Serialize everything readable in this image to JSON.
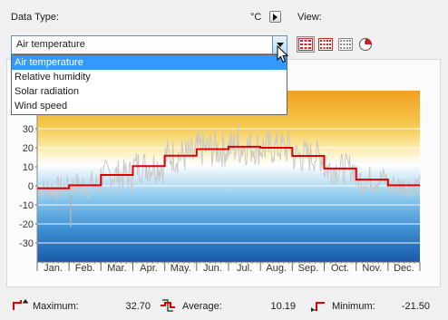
{
  "header": {
    "data_type_label": "Data Type:",
    "unit_label": "°C",
    "view_label": "View:"
  },
  "combo": {
    "selected": "Air temperature",
    "options": [
      "Air temperature",
      "Relative humidity",
      "Solar radiation",
      "Wind speed"
    ]
  },
  "view_buttons": [
    {
      "name": "monthly-view-icon",
      "active": true
    },
    {
      "name": "weekly-view-icon",
      "active": false
    },
    {
      "name": "daily-view-icon",
      "active": false
    },
    {
      "name": "clock-view-icon",
      "active": false
    }
  ],
  "chart_data": {
    "type": "line",
    "x_categories": [
      "Jan.",
      "Feb.",
      "Mar.",
      "Apr.",
      "May.",
      "Jun.",
      "Jul.",
      "Aug.",
      "Sep.",
      "Oct.",
      "Nov.",
      "Dec."
    ],
    "y_ticks": [
      30,
      20,
      10,
      0,
      -10,
      -20,
      -30
    ],
    "ylim": [
      -40,
      50
    ],
    "series": [
      {
        "kind": "monthly-average-step",
        "color": "#e00000",
        "values": [
          -1.3,
          0.3,
          5.7,
          10.4,
          15.8,
          19.3,
          20.5,
          20.0,
          15.7,
          9.1,
          3.3,
          0.3
        ]
      },
      {
        "kind": "hourly-values",
        "color": "#c8c8c8"
      }
    ],
    "min_marker": -21.5,
    "max_marker": 32.7
  },
  "stats": {
    "maximum_label": "Maximum:",
    "maximum_value": "32.70",
    "average_label": "Average:",
    "average_value": "10.19",
    "minimum_label": "Minimum:",
    "minimum_value": "-21.50"
  },
  "colors": {
    "warm_top": "#f0a020",
    "cold_bottom": "#1a5aa8",
    "selection": "#3399ff",
    "focus_border": "#5a8fd0"
  }
}
